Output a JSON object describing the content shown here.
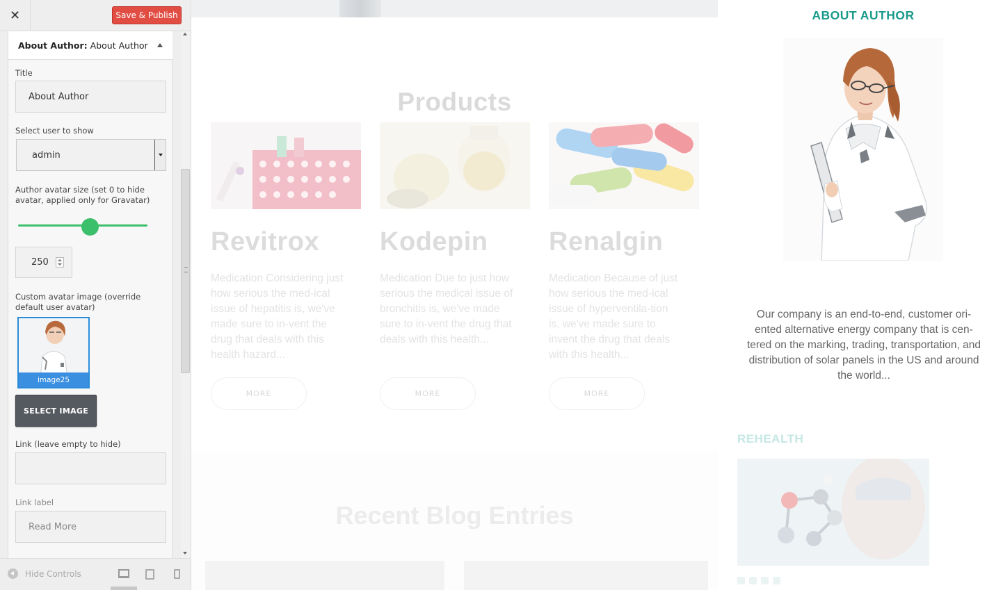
{
  "customizer": {
    "close_icon": "close-icon",
    "save_label": "Save & Publish",
    "panel": {
      "section_label": "About Author:",
      "section_name": "About Author",
      "title_label": "Title",
      "title_value": "About Author",
      "select_user_label": "Select user to show",
      "select_user_value": "admin",
      "avatar_size_label": "Author avatar size (set 0 to hide avatar, applied only for Gravatar)",
      "avatar_size_value": "250",
      "custom_avatar_label": "Custom avatar image (override default user avatar)",
      "custom_avatar_caption": "image25",
      "select_image_label": "SELECT IMAGE",
      "link_label": "Link (leave empty to hide)",
      "link_value": "",
      "link_text_label": "Link label",
      "link_text_placeholder": "Read More"
    },
    "footer": {
      "hide_controls_label": "Hide Controls",
      "devices": [
        "desktop",
        "tablet",
        "mobile"
      ]
    },
    "accent_color": "#3cbf6b",
    "save_color": "#e14d43"
  },
  "preview": {
    "products_title": "Products",
    "products": [
      {
        "name": "Revitrox",
        "description": "Medication Considering just how serious the med-ical issue of hepatitis is, we've made sure to in-vent the drug that deals with this health hazard...",
        "more": "MORE"
      },
      {
        "name": "Kodepin",
        "description": "Medication Due to just how serious the medical issue of bronchitis is, we've made sure to in-vent the drug that deals with this health...",
        "more": "MORE"
      },
      {
        "name": "Renalgin",
        "description": "Medication Because of just how serious the med-ical issue of hyperventila-tion is, we've made sure to invent the drug that deals with this health...",
        "more": "MORE"
      }
    ],
    "blog_title": "Recent Blog Entries",
    "sidebar": {
      "about_title": "ABOUT AUTHOR",
      "about_text": "Our company is an end-to-end, customer ori-ented alternative energy company that is cen-tered on the marking, trading, transportation, and distribution of solar panels in the US and around the world...",
      "rehealth_title": "REHEALTH",
      "title_color": "#1a9a8a"
    }
  }
}
